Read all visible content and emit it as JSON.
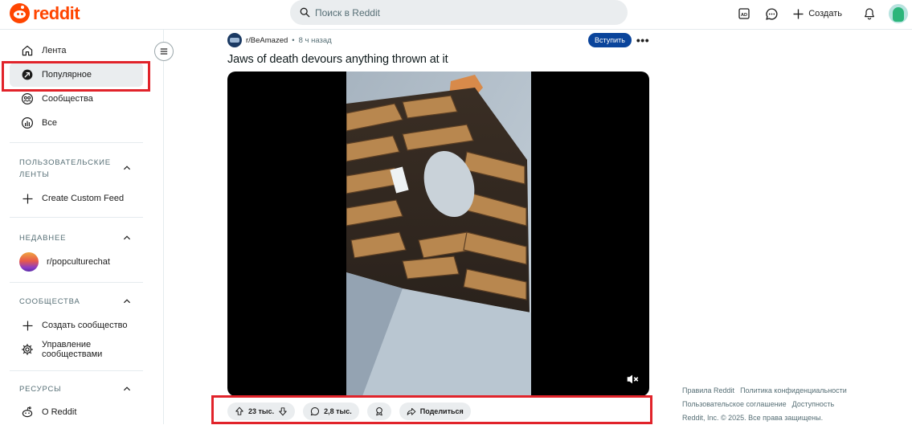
{
  "header": {
    "logo_text": "reddit",
    "search_placeholder": "Поиск в Reddit",
    "create_label": "Создать",
    "icons": [
      "advertise-icon",
      "chat-icon",
      "plus-icon",
      "bell-icon"
    ]
  },
  "sidebar": {
    "nav": [
      {
        "label": "Лента",
        "icon": "home-icon"
      },
      {
        "label": "Популярное",
        "icon": "popular-icon",
        "active": true
      },
      {
        "label": "Сообщества",
        "icon": "communities-icon"
      },
      {
        "label": "Все",
        "icon": "all-icon"
      }
    ],
    "custom_feeds": {
      "title": "ПОЛЬЗОВАТЕЛЬСКИЕ ЛЕНТЫ",
      "items": [
        {
          "label": "Create Custom Feed",
          "icon": "plus-icon"
        }
      ]
    },
    "recent": {
      "title": "НЕДАВНЕЕ",
      "items": [
        {
          "label": "r/popculturechat",
          "icon": "subreddit-avatar"
        }
      ]
    },
    "communities": {
      "title": "СООБЩЕСТВА",
      "items": [
        {
          "label": "Создать сообщество",
          "icon": "plus-icon"
        },
        {
          "label": "Управление сообществами",
          "icon": "gear-icon"
        }
      ]
    },
    "resources": {
      "title": "РЕСУРСЫ",
      "items": [
        {
          "label": "О Reddit",
          "icon": "reddit-icon"
        }
      ]
    }
  },
  "post": {
    "subreddit": "r/BeAmazed",
    "separator": "•",
    "time": "8 ч назад",
    "join_label": "Вступить",
    "more_label": "•••",
    "title": "Jaws of death devours anything thrown at it",
    "votes": "23 тыс.",
    "comments": "2,8 тыс.",
    "share_label": "Поделиться"
  },
  "footer": {
    "links_row1": [
      "Правила Reddit",
      "Политика конфиденциальности"
    ],
    "links_row2": [
      "Пользовательское соглашение",
      "Доступность"
    ],
    "copyright": "Reddit, Inc. © 2025. Все права защищены."
  },
  "colors": {
    "brand": "#ff4500",
    "join_button": "#0a449b",
    "highlight_box": "#e1232a",
    "pill_bg": "#eaedef"
  }
}
